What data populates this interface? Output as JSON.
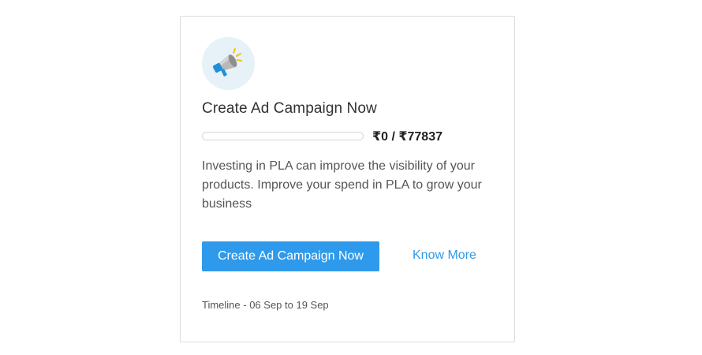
{
  "card": {
    "icon": "megaphone-icon",
    "title": "Create Ad Campaign Now",
    "progress": {
      "text": "₹0 / ₹77837",
      "spent": 0,
      "total": 77837
    },
    "description": "Investing in PLA can improve the visibility of your products. Improve your spend in PLA to grow your business",
    "primary_button_label": "Create Ad Campaign Now",
    "link_label": "Know More",
    "timeline": "Timeline - 06 Sep to 19 Sep"
  },
  "colors": {
    "accent": "#2f9aeb",
    "icon_bg": "#e6f1f8"
  }
}
